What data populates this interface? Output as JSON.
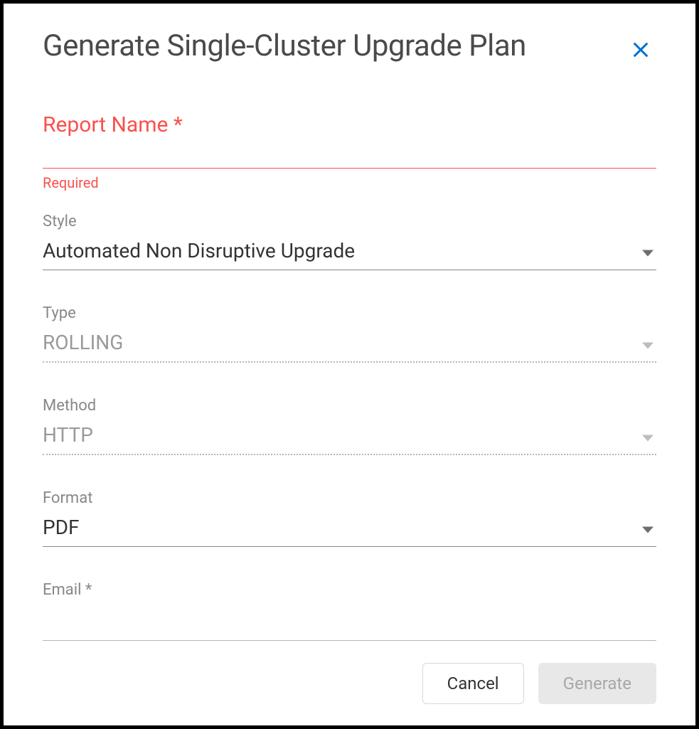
{
  "dialog": {
    "title": "Generate Single-Cluster Upgrade Plan"
  },
  "fields": {
    "report_name": {
      "label": "Report Name *",
      "value": "",
      "helper": "Required"
    },
    "style": {
      "label": "Style",
      "value": "Automated Non Disruptive Upgrade"
    },
    "type": {
      "label": "Type",
      "value": "ROLLING"
    },
    "method": {
      "label": "Method",
      "value": "HTTP"
    },
    "format": {
      "label": "Format",
      "value": "PDF"
    },
    "email": {
      "label": "Email *",
      "value": ""
    }
  },
  "footer": {
    "cancel": "Cancel",
    "generate": "Generate"
  }
}
